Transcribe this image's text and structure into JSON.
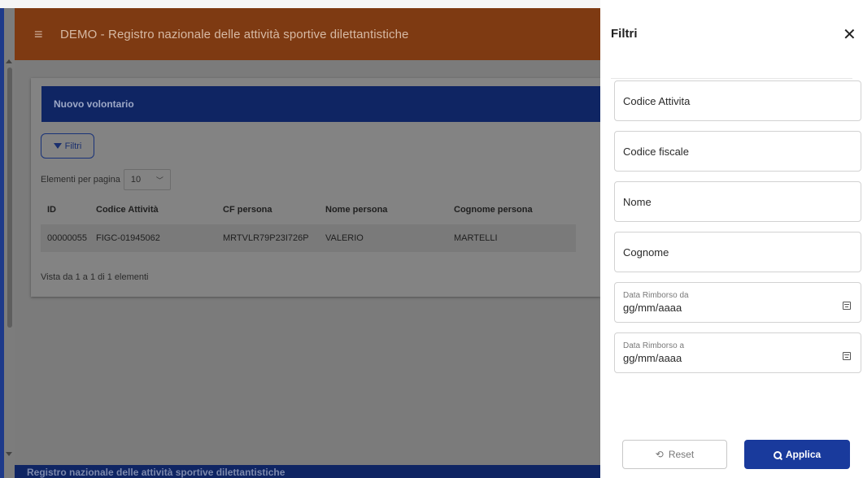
{
  "app": {
    "title": "DEMO - Registro nazionale delle attività sportive dilettantistiche",
    "footer_text": "Registro nazionale delle attività sportive dilettantistiche"
  },
  "card": {
    "header": "Nuovo volontario",
    "filter_button": "Filtri",
    "per_page_label": "Elementi per pagina",
    "per_page_value": "10",
    "summary": "Vista da 1 a 1 di 1 elementi"
  },
  "table": {
    "columns": [
      "ID",
      "Codice Attività",
      "CF persona",
      "Nome persona",
      "Cognome persona"
    ],
    "rows": [
      [
        "00000055",
        "FIGC-01945062",
        "MRTVLR79P23I726P",
        "VALERIO",
        "MARTELLI"
      ]
    ]
  },
  "panel": {
    "title": "Filtri",
    "fields": {
      "codice_attivita": "Codice Attivita",
      "codice_fiscale": "Codice fiscale",
      "nome": "Nome",
      "cognome": "Cognome",
      "data_da_label": "Data Rimborso da",
      "data_da_value": "gg/mm/aaaa",
      "data_a_label": "Data Rimborso a",
      "data_a_value": "gg/mm/aaaa"
    },
    "reset_label": "Reset",
    "apply_label": "Applica"
  },
  "colors": {
    "header_orange": "#7e3a12",
    "navy": "#0f2563",
    "apply_button": "#193a9c"
  }
}
